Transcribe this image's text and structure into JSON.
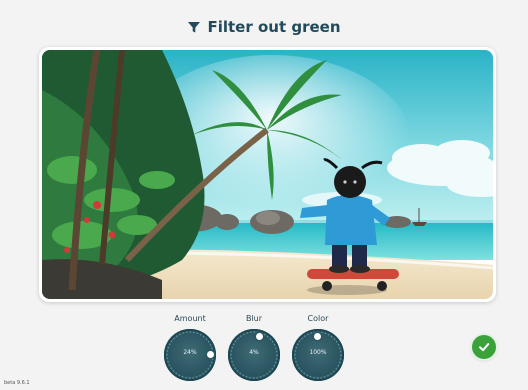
{
  "header": {
    "title": "Filter out green",
    "icon": "funnel-icon"
  },
  "image": {
    "scene": "beach-skateboarder"
  },
  "controls": {
    "amount": {
      "label": "Amount",
      "value": "24%",
      "level": 0.24
    },
    "blur": {
      "label": "Blur",
      "value": "4%",
      "level": 0.04
    },
    "color": {
      "label": "Color",
      "value": "100%",
      "level": 1.0
    }
  },
  "confirm": {
    "icon": "checkmark-icon",
    "color": "#3ba23b"
  },
  "footer": {
    "version": "beta 9.6.1"
  },
  "colors": {
    "accent": "#214a5a",
    "dial": "#2a5561"
  }
}
